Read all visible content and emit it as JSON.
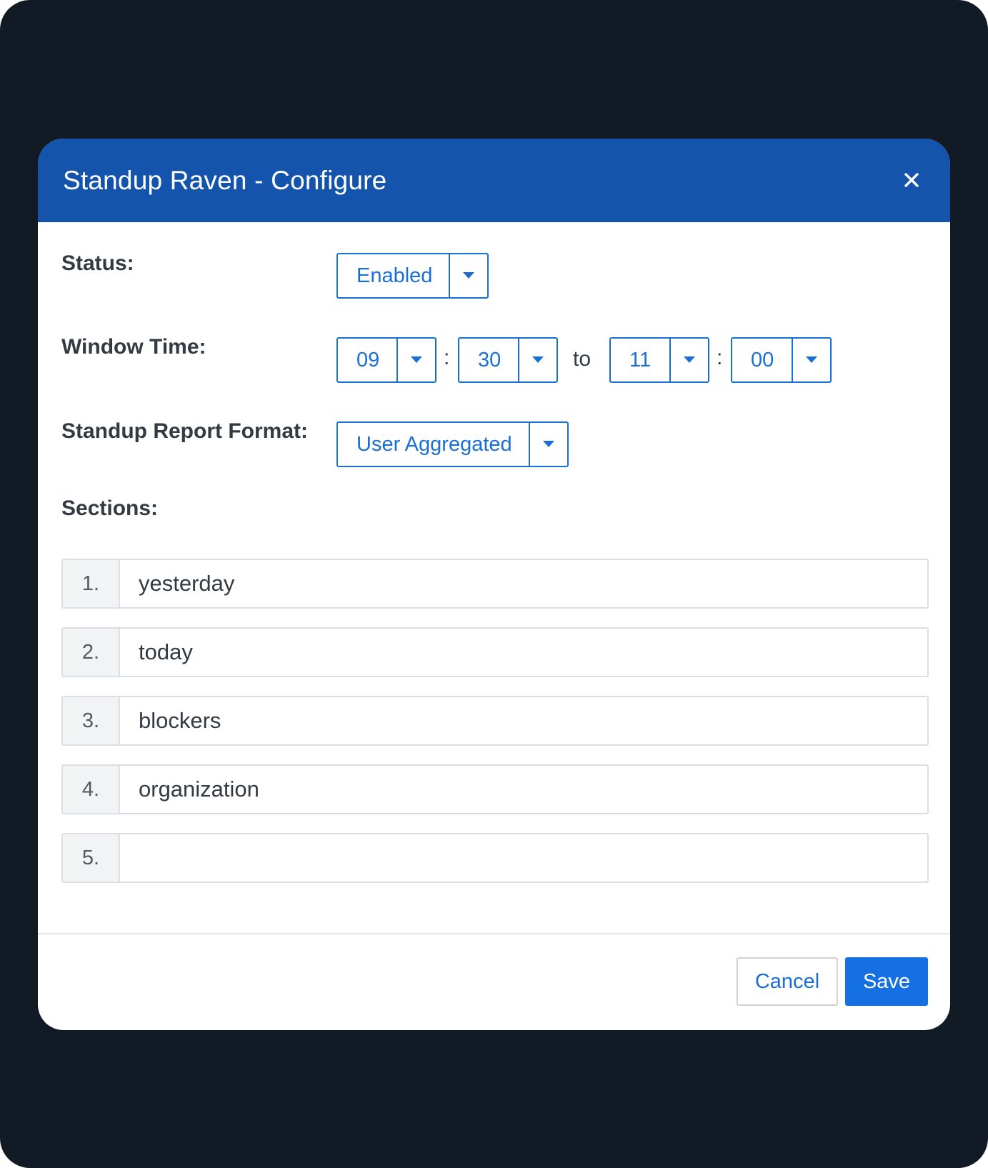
{
  "modal": {
    "title": "Standup Raven - Configure"
  },
  "form": {
    "status": {
      "label": "Status:",
      "value": "Enabled"
    },
    "window_time": {
      "label": "Window Time:",
      "start_hour": "09",
      "start_minute": "30",
      "separator": ":",
      "to_text": "to",
      "end_hour": "11",
      "end_minute": "00"
    },
    "report_format": {
      "label": "Standup Report Format:",
      "value": "User Aggregated"
    },
    "sections": {
      "label": "Sections:",
      "items": [
        {
          "number": "1.",
          "value": "yesterday"
        },
        {
          "number": "2.",
          "value": "today"
        },
        {
          "number": "3.",
          "value": "blockers"
        },
        {
          "number": "4.",
          "value": "organization"
        },
        {
          "number": "5.",
          "value": ""
        }
      ]
    }
  },
  "footer": {
    "cancel_label": "Cancel",
    "save_label": "Save"
  },
  "colors": {
    "header": "#1554ad",
    "accent": "#1a6fd6",
    "save_button": "#1570e3",
    "backdrop": "#111a25"
  },
  "icons": {
    "close": "close-icon",
    "dropdown": "caret-down-icon"
  }
}
